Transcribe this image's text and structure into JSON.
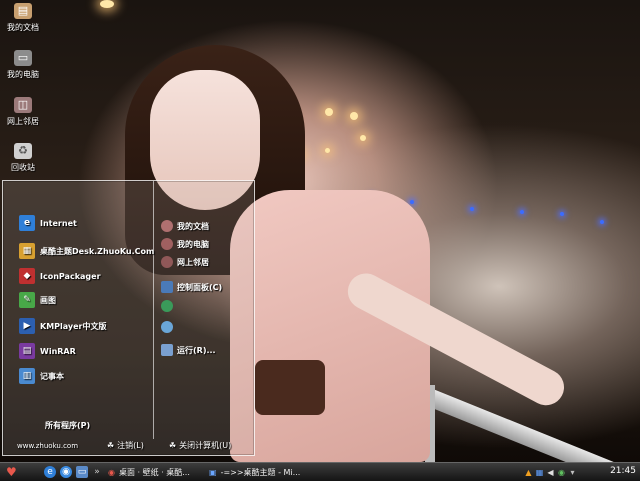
{
  "desktop": {
    "icons": [
      {
        "label": "我的文档",
        "icon": "my-documents-icon"
      },
      {
        "label": "我的电脑",
        "icon": "my-computer-icon"
      },
      {
        "label": "网上邻居",
        "icon": "network-places-icon"
      },
      {
        "label": "回收站",
        "icon": "recycle-bin-icon"
      }
    ]
  },
  "start_menu": {
    "pinned": [
      {
        "label": "Internet",
        "icon": "internet-explorer-icon"
      },
      {
        "label": "桌酷主题Desk.ZhuoKu.Com",
        "icon": "zhuoku-theme-icon"
      },
      {
        "label": "IconPackager",
        "icon": "iconpackager-icon"
      },
      {
        "label": "画图",
        "icon": "paint-icon"
      },
      {
        "label": "KMPlayer中文版",
        "icon": "kmplayer-icon"
      },
      {
        "label": "WinRAR",
        "icon": "winrar-icon"
      },
      {
        "label": "记事本",
        "icon": "notepad-icon"
      }
    ],
    "all_programs": "所有程序(P)",
    "places": [
      {
        "label": "我的文档",
        "icon": "my-documents-icon"
      },
      {
        "label": "我的电脑",
        "icon": "my-computer-icon"
      },
      {
        "label": "网上邻居",
        "icon": "network-places-icon"
      },
      {
        "label": "控制面板(C)",
        "icon": "control-panel-icon"
      },
      {
        "label": "",
        "icon": "help-icon"
      },
      {
        "label": "",
        "icon": "search-icon"
      },
      {
        "label": "运行(R)...",
        "icon": "run-icon"
      }
    ],
    "footer": {
      "url": "www.zhuoku.com",
      "logoff": "注销(L)",
      "shutdown": "关闭计算机(U)"
    }
  },
  "taskbar": {
    "start_icon": "heart-start-icon",
    "tasks": [
      {
        "label": "桌面 · 壁纸 · 桌酷...",
        "icon": "browser-icon"
      },
      {
        "label": "-=>>桌酷主题 - Mi...",
        "icon": "window-icon"
      }
    ],
    "clock": "21:45"
  },
  "colors": {
    "taskbar_bg": "#1e1e1e",
    "menu_border": "#ffffff",
    "start_heart": "#e8584c"
  }
}
